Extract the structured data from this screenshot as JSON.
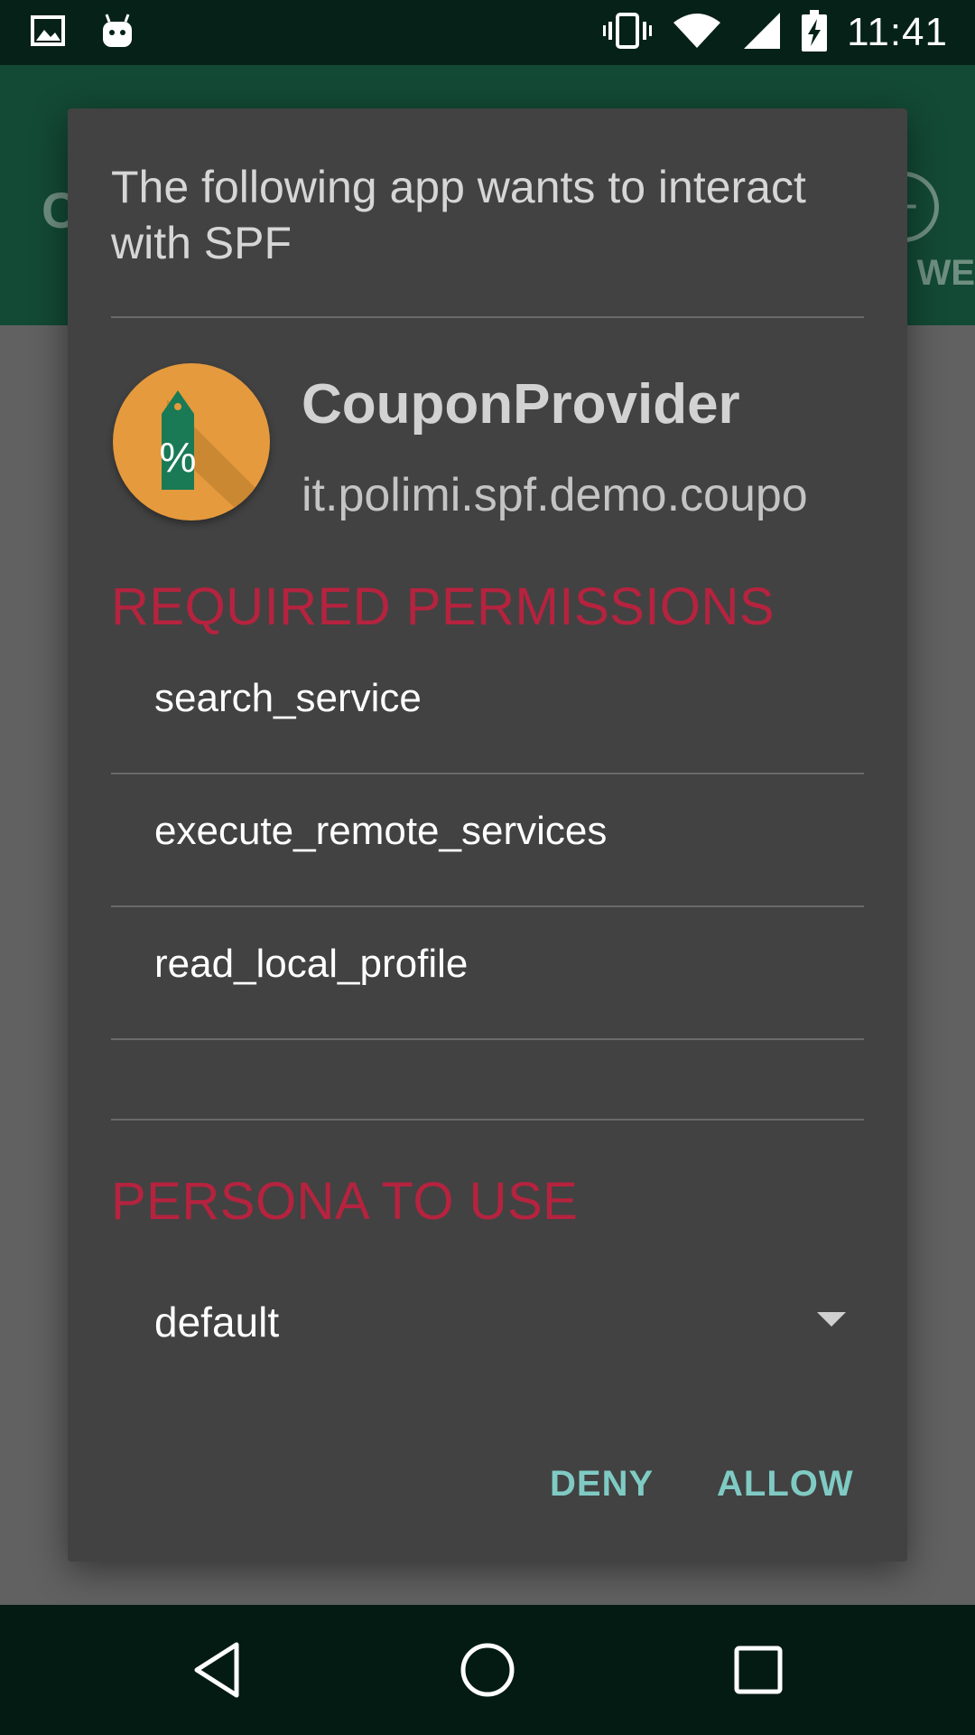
{
  "status_bar": {
    "time": "11:41",
    "icons": [
      "image-notification-icon",
      "android-notification-icon",
      "vibrate-icon",
      "wifi-icon",
      "signal-icon",
      "battery-charging-icon"
    ]
  },
  "background_app": {
    "title_peek": "C",
    "tab_peek": "WE"
  },
  "dialog": {
    "title": "The following app wants to interact with SPF",
    "app": {
      "name": "CouponProvider",
      "package": "it.polimi.spf.demo.coupo",
      "icon": "coupon-tag-icon",
      "icon_glyph": "%"
    },
    "permissions_header": "REQUIRED PERMISSIONS",
    "permissions": [
      {
        "label": "search_service"
      },
      {
        "label": "execute_remote_services"
      },
      {
        "label": "read_local_profile"
      }
    ],
    "persona_header": "PERSONA TO USE",
    "persona": {
      "selected": "default"
    },
    "buttons": {
      "deny": "DENY",
      "allow": "ALLOW"
    }
  },
  "colors": {
    "accent_red": "#b5233f",
    "button_teal": "#7fcbc4",
    "dialog_bg": "#424242",
    "status_bar": "#062118",
    "app_bar": "#134a35",
    "icon_orange": "#e59a3d",
    "tag_green": "#1a7a55"
  }
}
